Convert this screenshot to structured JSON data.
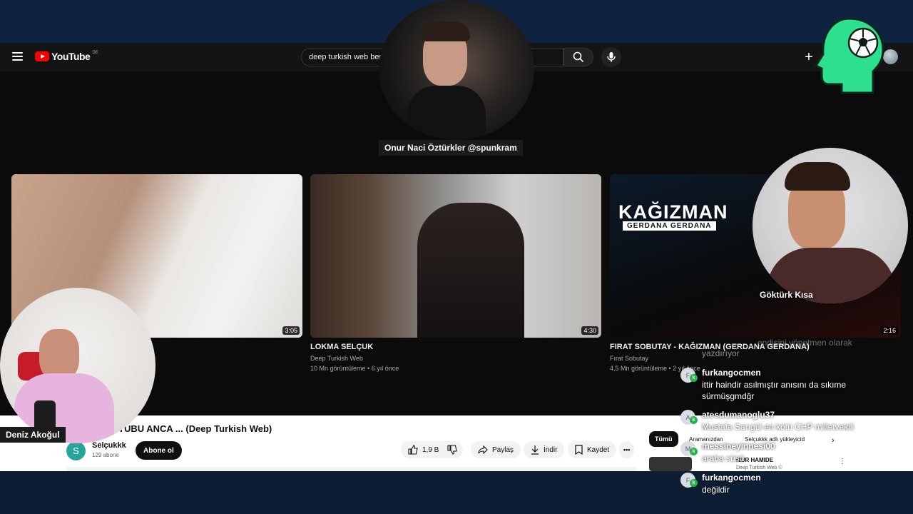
{
  "youtube": {
    "logo_text": "YouTube",
    "logo_region": "DE",
    "search": {
      "value": "deep turkish web ben"
    },
    "videos": [
      {
        "title": "",
        "channel": "",
        "meta": "",
        "duration": "3:05"
      },
      {
        "title": "LOKMA SELÇUK",
        "channel": "Deep Turkish Web",
        "meta": "10 Mn görüntüleme • 6 yıl önce",
        "duration": "4:30"
      },
      {
        "title": "FIRAT SOBUTAY - KAĞIZMAN (GERDANA GERDANA)",
        "channel": "Fırat Sobutay",
        "meta": "4,5 Mn görüntüleme • 2 yıl önce",
        "duration": "2:16",
        "thumb_text": "KAĞIZMAN",
        "thumb_subtext": "GERDANA GERDANA"
      }
    ],
    "watch": {
      "title": "TUBU ANCA ... (Deep Turkish Web)",
      "channel": "Selçukkk",
      "channel_initial": "S",
      "subscribers": "129 abone",
      "subscribe_label": "Abone ol",
      "like_count": "1,9 B",
      "share_label": "Paylaş",
      "download_label": "İndir",
      "save_label": "Kaydet",
      "more_label": "•••",
      "filter_all": "Tümü",
      "chip_1": "Aramanızdan",
      "chip_2": "Selçukkk adlı yükleyicid",
      "side_title": "NIJR HAMIDE",
      "side_sub": "Deep Turkish Web ©"
    }
  },
  "streamers": {
    "top": "Onur Naci Öztürkler @spunkram",
    "right": "Göktürk Kısa",
    "left": "Deniz Akoğul"
  },
  "chat": {
    "faded_line": "yazdırıyor",
    "faded_line_2": "endisini yönetmen olarak",
    "messages": [
      {
        "initial": "F",
        "user": "furkangocmen",
        "text": "ittir haindir asılmıştır anısını da sıkıme sürmüşgmdğr"
      },
      {
        "initial": "A",
        "user": "atesdumanoglu37",
        "text": "Mustafa Sarıgül en kötü CHP milletvekili"
      },
      {
        "initial": "M",
        "user": "messineyinnesi00",
        "text": "araba süsü"
      },
      {
        "initial": "F",
        "user": "furkangocmen",
        "text": "değildir"
      }
    ]
  },
  "colors": {
    "brand_red": "#ff0000",
    "overlay_logo": "#2de08f",
    "chat_badge": "#27b34a"
  }
}
